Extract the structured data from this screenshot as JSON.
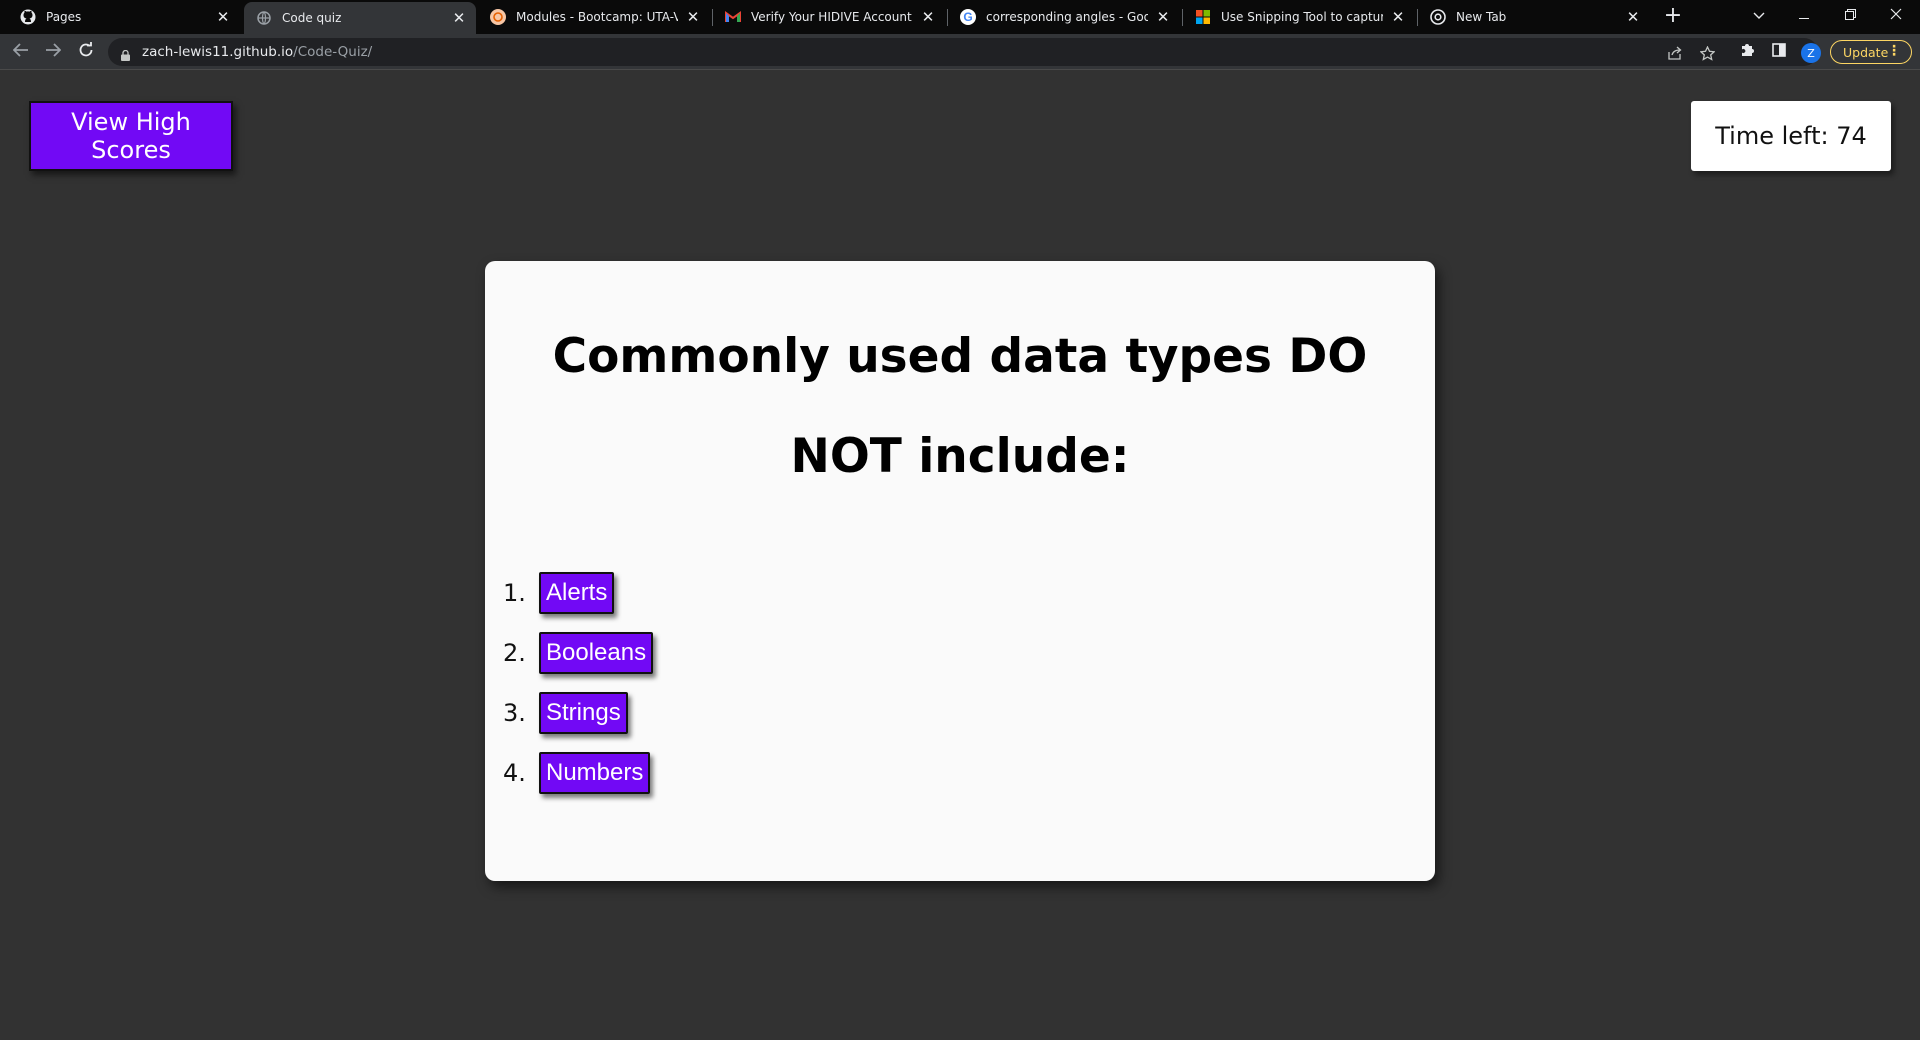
{
  "browser": {
    "tabs": [
      {
        "title": "Pages",
        "icon": "github-icon"
      },
      {
        "title": "Code quiz",
        "icon": "globe-icon",
        "active": true
      },
      {
        "title": "Modules - Bootcamp: UTA-VIRT",
        "icon": "canvas-icon"
      },
      {
        "title": "Verify Your HIDIVE Account to St",
        "icon": "gmail-icon"
      },
      {
        "title": "corresponding angles - Google",
        "icon": "google-icon"
      },
      {
        "title": "Use Snipping Tool to capture sc",
        "icon": "microsoft-icon"
      },
      {
        "title": "New Tab",
        "icon": "chrome-icon"
      }
    ],
    "url_host": "zach-lewis11.github.io",
    "url_path": "/Code-Quiz/",
    "profile_initial": "Z",
    "update_label": "Update",
    "colors": {
      "update": "#fdd663",
      "profile": "#1a73e8"
    }
  },
  "page": {
    "highscores_label": "View High Scores",
    "timer_text": "Time left: 74",
    "question": "Commonly used data types DO NOT include:",
    "answers": [
      {
        "number": "1.",
        "label": "Alerts"
      },
      {
        "number": "2.",
        "label": "Booleans"
      },
      {
        "number": "3.",
        "label": "Strings"
      },
      {
        "number": "4.",
        "label": "Numbers"
      }
    ],
    "colors": {
      "accent": "#7209f5",
      "background": "#323232",
      "card": "#fafafa"
    }
  }
}
